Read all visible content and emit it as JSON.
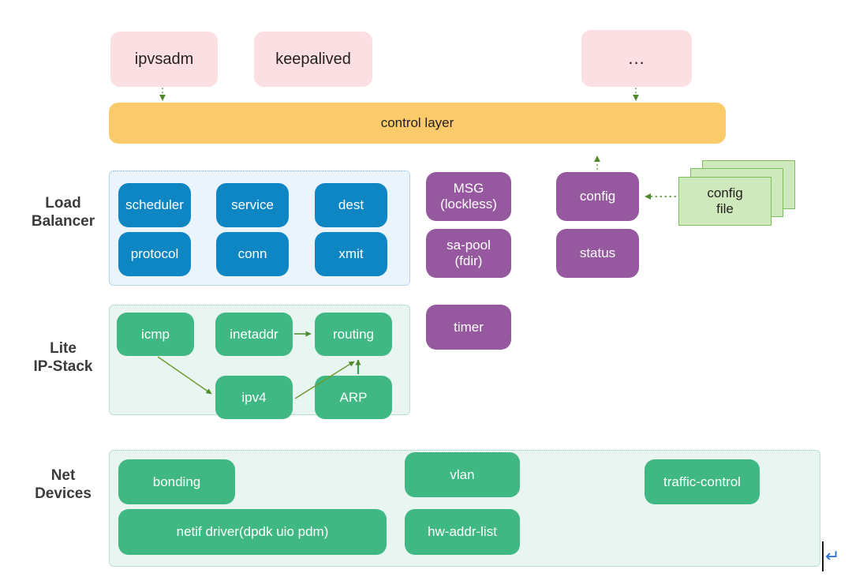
{
  "diagram": {
    "title": "DPVS architecture layers",
    "colors": {
      "pink": "#fbdfe2",
      "orange": "#fbcb6b",
      "blue": "#0e86c4",
      "purple": "#96589f",
      "green": "#3fb883",
      "panel_blue_fill": "#eaf4fa",
      "panel_blue_border": "#7fb6d8",
      "panel_green_fill": "#e8f5f1",
      "panel_green_border": "#8fc9bb",
      "file_fill": "#cfe9bd",
      "file_border": "#7dbf5e",
      "arrow": "#4f8a2b",
      "caret": "#2a6fd6",
      "label_text": "#3b3b3b"
    }
  },
  "apps": [
    {
      "label": "ipvsadm"
    },
    {
      "label": "keepalived"
    },
    {
      "label": "..."
    }
  ],
  "control_layer": {
    "label": "control layer"
  },
  "sections": [
    {
      "label": "Load\nBalancer"
    },
    {
      "label": "Lite\nIP-Stack"
    },
    {
      "label": "Net\nDevices"
    }
  ],
  "load_balancer": {
    "modules": [
      {
        "label": "scheduler"
      },
      {
        "label": "service"
      },
      {
        "label": "dest"
      },
      {
        "label": "protocol"
      },
      {
        "label": "conn"
      },
      {
        "label": "xmit"
      }
    ],
    "side_modules": [
      {
        "label": "MSG\n(lockless)"
      },
      {
        "label": "sa-pool\n(fdir)"
      },
      {
        "label": "config"
      },
      {
        "label": "status"
      }
    ]
  },
  "config_file": {
    "label": "config\nfile",
    "sheets": 3
  },
  "ip_stack": {
    "modules": [
      {
        "label": "icmp"
      },
      {
        "label": "inetaddr"
      },
      {
        "label": "routing"
      },
      {
        "label": "ipv4"
      },
      {
        "label": "ARP"
      }
    ],
    "side_modules": [
      {
        "label": "timer"
      }
    ]
  },
  "net_devices": {
    "modules": [
      {
        "label": "bonding"
      },
      {
        "label": "vlan"
      },
      {
        "label": "traffic-control"
      },
      {
        "label": "netif driver(dpdk uio pdm)"
      },
      {
        "label": "hw-addr-list"
      }
    ]
  },
  "cursor": {
    "glyph": "↵"
  }
}
